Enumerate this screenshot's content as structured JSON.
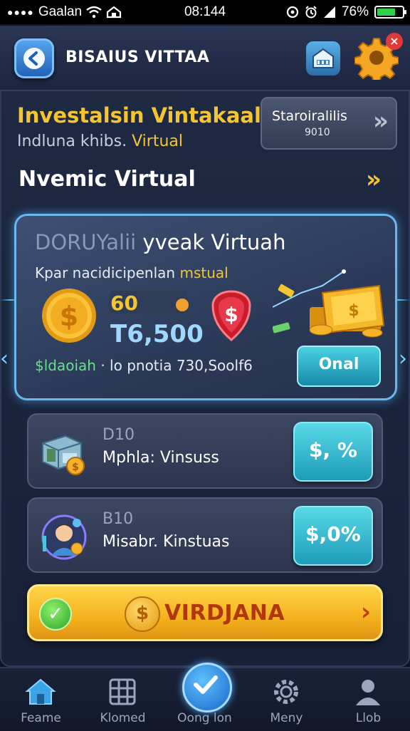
{
  "status_bar": {
    "signal_dots": "●●●●",
    "carrier": "Gaalan",
    "time": "08:144",
    "battery": "76%",
    "battery_level": 0.76
  },
  "header": {
    "title": "BISAIUS VITTAA",
    "back_icon": "back-arrow-icon",
    "store_icon": "store-icon",
    "settings_icon": "gear-icon",
    "close_badge": "×"
  },
  "hero": {
    "headline": "Investalsin Vintakaal",
    "sub_prefix": "Indluna khibs.",
    "sub_highlight": "Virtual",
    "stat_button": {
      "line1": "Staroiralilis",
      "line2": "9010"
    }
  },
  "section": {
    "title": "Nvemic Virtual"
  },
  "main_card": {
    "title_dim": "DORUYalii",
    "title": "yveak Virtuah",
    "sub_prefix": "Kpar nacidicipenlan",
    "sub_highlight": "mstual",
    "value_small": "60",
    "value_big": "T6,500",
    "footer_highlight": "$ldaoiah",
    "footer_rest": "· lo pnotia 730,Soolf6",
    "action_label": "Onal"
  },
  "list": [
    {
      "code": "D10",
      "name": "Mphla: Vinsuss",
      "button": "$, %"
    },
    {
      "code": "B10",
      "name": "Misabr. Kinstuas",
      "button": "$,0%"
    }
  ],
  "cta": {
    "label": "VIRDJANA",
    "coin": "$"
  },
  "nav": [
    {
      "label": "Feame",
      "icon": "home-icon"
    },
    {
      "label": "Klomed",
      "icon": "grid-icon"
    },
    {
      "label": "Oong lon",
      "icon": "check-circle-icon"
    },
    {
      "label": "Meny",
      "icon": "gear-icon"
    },
    {
      "label": "Llob",
      "icon": "user-icon"
    }
  ],
  "colors": {
    "accent_gold": "#f4c531",
    "accent_cyan": "#4ad1e2",
    "card_border": "#6ab6ee",
    "background": "#141a2c"
  }
}
